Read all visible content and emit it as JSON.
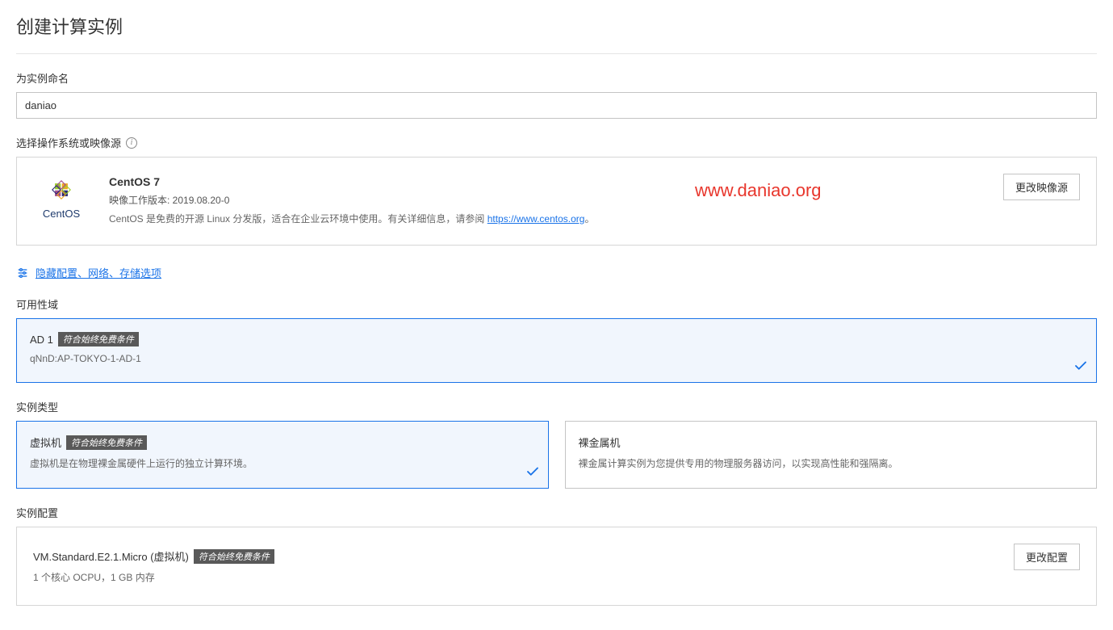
{
  "pageTitle": "创建计算实例",
  "instanceNameLabel": "为实例命名",
  "instanceNameValue": "daniao",
  "osSourceLabel": "选择操作系统或映像源",
  "os": {
    "logoText": "CentOS",
    "name": "CentOS 7",
    "versionLabel": "映像工作版本: 2019.08.20-0",
    "descPrefix": "CentOS 是免费的开源 Linux 分发版，适合在企业云环境中使用。有关详细信息，请参阅 ",
    "descLink": "https://www.centos.org",
    "descSuffix": "。",
    "changeButton": "更改映像源"
  },
  "watermark": "www.daniao.org",
  "hideConfigLink": "隐藏配置、网络、存储选项",
  "adSectionLabel": "可用性域",
  "ad": {
    "title": "AD 1",
    "badge": "符合始终免费条件",
    "sub": "qNnD:AP-TOKYO-1-AD-1"
  },
  "typeSectionLabel": "实例类型",
  "types": {
    "vm": {
      "title": "虚拟机",
      "badge": "符合始终免费条件",
      "desc": "虚拟机是在物理裸金属硬件上运行的独立计算环境。"
    },
    "bm": {
      "title": "裸金属机",
      "desc": "裸金属计算实例为您提供专用的物理服务器访问，以实现高性能和强隔离。"
    }
  },
  "shapeSectionLabel": "实例配置",
  "shape": {
    "name": "VM.Standard.E2.1.Micro (虚拟机)",
    "badge": "符合始终免费条件",
    "desc": "1 个核心 OCPU，1 GB 内存",
    "changeButton": "更改配置"
  }
}
